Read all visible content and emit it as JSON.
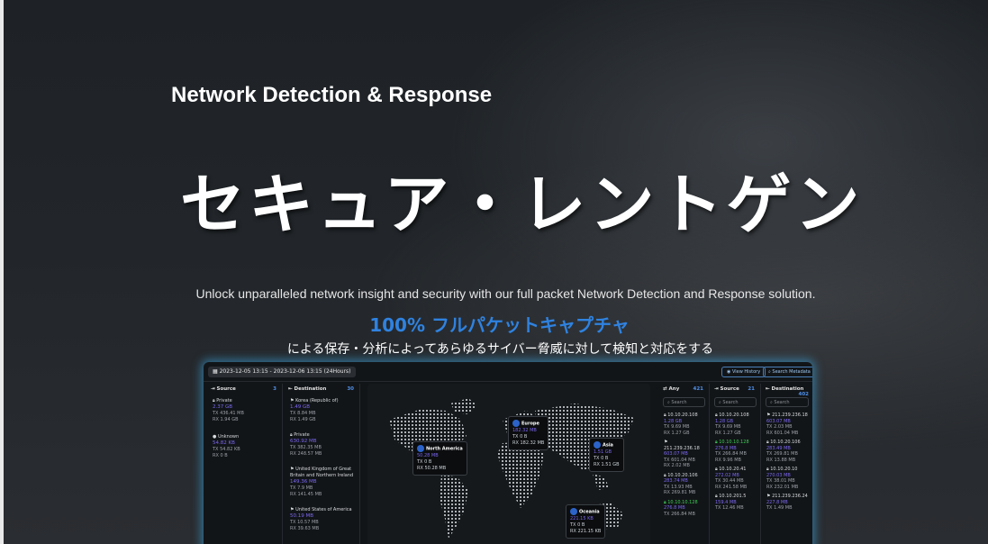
{
  "hero": {
    "eyebrow": "Network Detection & Response",
    "title": "セキュア・レントゲン",
    "subline": "Unlock unparalleled network insight and security with our full packet Network Detection and Response solution.",
    "highlight": "100% フルパケットキャプチャ",
    "description": "による保存・分析によってあらゆるサイバー脅威に対して検知と対応をする"
  },
  "dashboard": {
    "date_range": "2023-12-05 13:15 - 2023-12-06 13:15 (24Hours)",
    "view_history": "View History",
    "search_metadata": "Search Metadata",
    "source": {
      "title": "Source",
      "count": "3",
      "entries": [
        {
          "name": "Private",
          "size": "2.37 GB",
          "tx": "TX 436.41 MB",
          "rx": "RX 1.94 GB"
        },
        {
          "name": "Unknown",
          "size": "54.82 KB",
          "tx": "TX 54.82 KB",
          "rx": "RX 0 B"
        }
      ]
    },
    "destination": {
      "title": "Destination",
      "count": "30",
      "entries": [
        {
          "name": "Korea (Republic of)",
          "size": "1.49 GB",
          "tx": "TX 8.84 MB",
          "rx": "RX 1.49 GB"
        },
        {
          "name": "Private",
          "size": "630.92 MB",
          "tx": "TX 382.35 MB",
          "rx": "RX 248.57 MB"
        },
        {
          "name": "United Kingdom of Great Britain and Northern Ireland",
          "size": "149.36 MB",
          "tx": "TX 7.9 MB",
          "rx": "RX 141.45 MB"
        },
        {
          "name": "United States of America",
          "size": "50.19 MB",
          "tx": "TX 10.57 MB",
          "rx": "RX 39.63 MB"
        }
      ]
    },
    "map": {
      "regions": [
        {
          "name": "North America",
          "size": "50.28 MB",
          "tx": "TX 0 B",
          "rx": "RX 50.28 MB"
        },
        {
          "name": "Europe",
          "size": "182.32 MB",
          "tx": "TX 0 B",
          "rx": "RX 182.32 MB"
        },
        {
          "name": "Asia",
          "size": "1.51 GB",
          "tx": "TX 0 B",
          "rx": "RX 1.51 GB"
        },
        {
          "name": "Oceania",
          "size": "221.15 KB",
          "tx": "TX 0 B",
          "rx": "RX 221.15 KB"
        }
      ]
    },
    "any": {
      "title": "Any",
      "count": "421",
      "search": "Search",
      "entries": [
        {
          "ip": "10.10.20.108",
          "size": "1.28 GB",
          "tx": "TX 9.69 MB",
          "rx": "RX 1.27 GB"
        },
        {
          "ip": "211.239.236.18",
          "size": "603.07 MB",
          "tx": "TX 601.04 MB",
          "rx": "RX 2.02 MB"
        },
        {
          "ip": "10.10.20.106",
          "size": "283.74 MB",
          "tx": "TX 13.93 MB",
          "rx": "RX 269.81 MB"
        },
        {
          "ip": "10.10.10.128",
          "size": "276.8 MB",
          "tx": "TX 266.84 MB",
          "rx": ""
        }
      ]
    },
    "source2": {
      "title": "Source",
      "count": "21",
      "search": "Search",
      "entries": [
        {
          "ip": "10.10.20.108",
          "size": "1.28 GB",
          "tx": "TX 9.69 MB",
          "rx": "RX 1.27 GB"
        },
        {
          "ip": "10.10.10.128",
          "size": "276.8 MB",
          "tx": "TX 266.84 MB",
          "rx": "RX 9.96 MB"
        },
        {
          "ip": "10.10.20.41",
          "size": "272.02 MB",
          "tx": "TX 30.44 MB",
          "rx": "RX 241.58 MB"
        },
        {
          "ip": "10.10.201.5",
          "size": "159.4 MB",
          "tx": "TX 12.46 MB",
          "rx": ""
        }
      ]
    },
    "destination2": {
      "title": "Destination",
      "count": "402",
      "search": "Search",
      "entries": [
        {
          "ip": "211.239.236.18",
          "size": "603.07 MB",
          "tx": "TX 2.03 MB",
          "rx": "RX 601.04 MB"
        },
        {
          "ip": "10.10.20.106",
          "size": "283.49 MB",
          "tx": "TX 269.81 MB",
          "rx": "RX 13.88 MB"
        },
        {
          "ip": "10.10.20.10",
          "size": "270.03 MB",
          "tx": "TX 38.01 MB",
          "rx": "RX 232.01 MB"
        },
        {
          "ip": "211.239.236.24",
          "size": "227.8 MB",
          "tx": "TX 1.49 MB",
          "rx": ""
        }
      ]
    }
  }
}
